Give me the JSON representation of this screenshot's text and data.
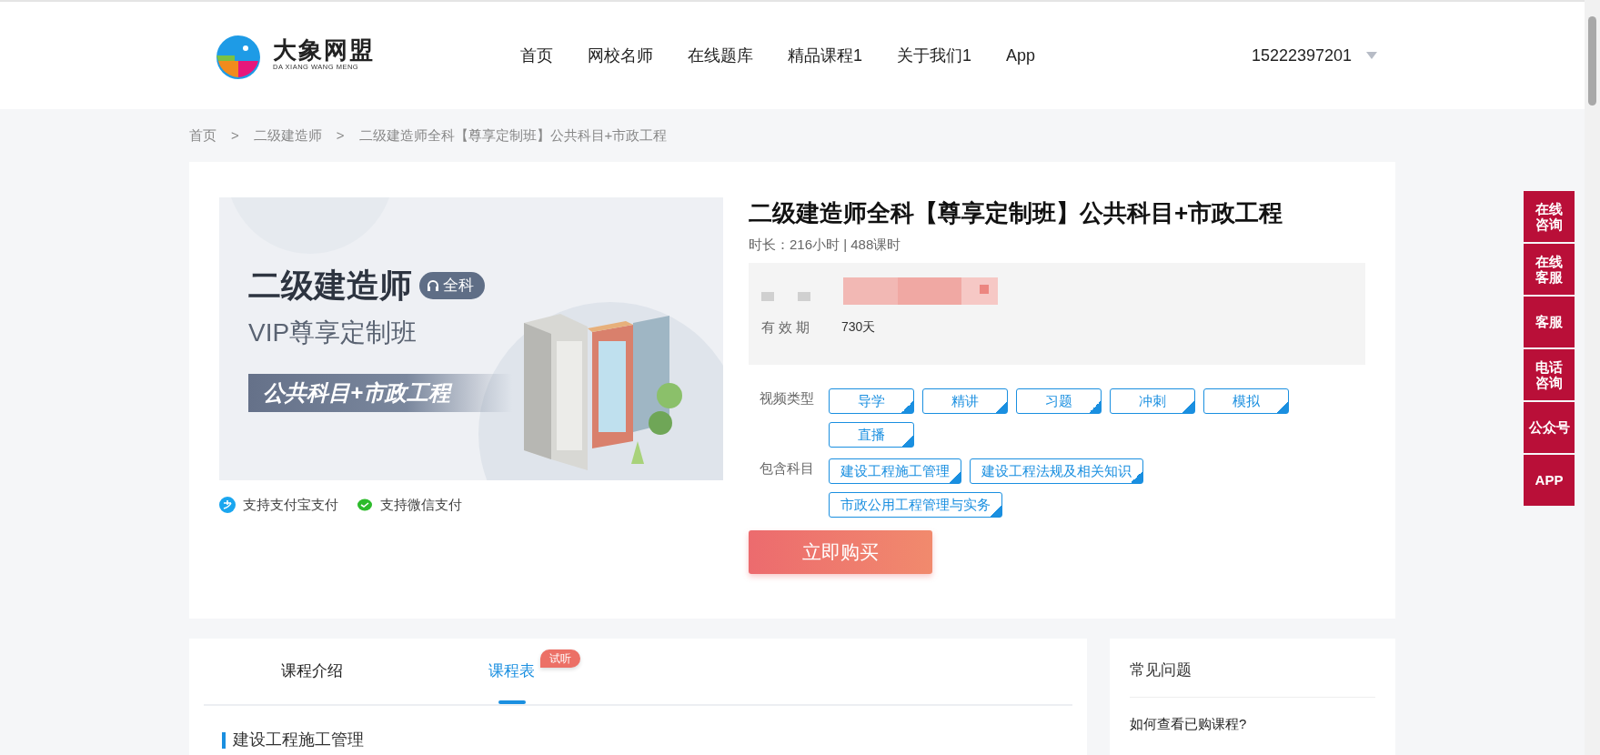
{
  "header": {
    "logo": {
      "name": "大象网盟",
      "subtitle": "DA XIANG WANG MENG"
    },
    "nav": [
      "首页",
      "网校名师",
      "在线题库",
      "精品课程1",
      "关于我们1",
      "App"
    ],
    "user": "15222397201"
  },
  "breadcrumb": {
    "separator": ">",
    "items": [
      "首页",
      "二级建造师",
      "二级建造师全科【尊享定制班】公共科目+市政工程"
    ]
  },
  "banner": {
    "title": "二级建造师",
    "badge": "全科",
    "subtitle": "VIP尊享定制班",
    "ribbon": "公共科目+市政工程"
  },
  "payments": [
    {
      "kind": "alipay",
      "label": "支持支付宝支付"
    },
    {
      "kind": "wechat",
      "label": "支持微信支付"
    }
  ],
  "course": {
    "title": "二级建造师全科【尊享定制班】公共科目+市政工程",
    "duration": "时长：216小时 | 488课时",
    "validity": {
      "label": "有 效 期",
      "value": "730天"
    },
    "video_types": {
      "label": "视频类型",
      "tags": [
        {
          "label": "导学",
          "selected": true
        },
        {
          "label": "精讲",
          "selected": true
        },
        {
          "label": "习题",
          "selected": true
        },
        {
          "label": "冲刺",
          "selected": true
        },
        {
          "label": "模拟",
          "selected": true
        },
        {
          "label": "直播",
          "selected": true
        }
      ]
    },
    "subjects": {
      "label": "包含科目",
      "tags": [
        {
          "label": "建设工程施工管理",
          "selected": true
        },
        {
          "label": "建设工程法规及相关知识",
          "selected": true
        },
        {
          "label": "市政公用工程管理与实务",
          "selected": true
        }
      ]
    },
    "buy_button": "立即购买"
  },
  "tabs": [
    {
      "label": "课程介绍",
      "selected": false
    },
    {
      "label": "课程表",
      "selected": true,
      "badge": "试听"
    }
  ],
  "schedule": [
    {
      "title": "建设工程施工管理"
    }
  ],
  "faq": {
    "title": "常见问题",
    "items": [
      "如何查看已购课程?"
    ]
  },
  "side_buttons": [
    {
      "lines": [
        "在线",
        "咨询"
      ]
    },
    {
      "lines": [
        "在线",
        "客服"
      ]
    },
    {
      "lines": [
        "客服"
      ]
    },
    {
      "lines": [
        "电话",
        "咨询"
      ]
    },
    {
      "lines": [
        "公众号"
      ]
    },
    {
      "lines": [
        "APP"
      ]
    }
  ]
}
